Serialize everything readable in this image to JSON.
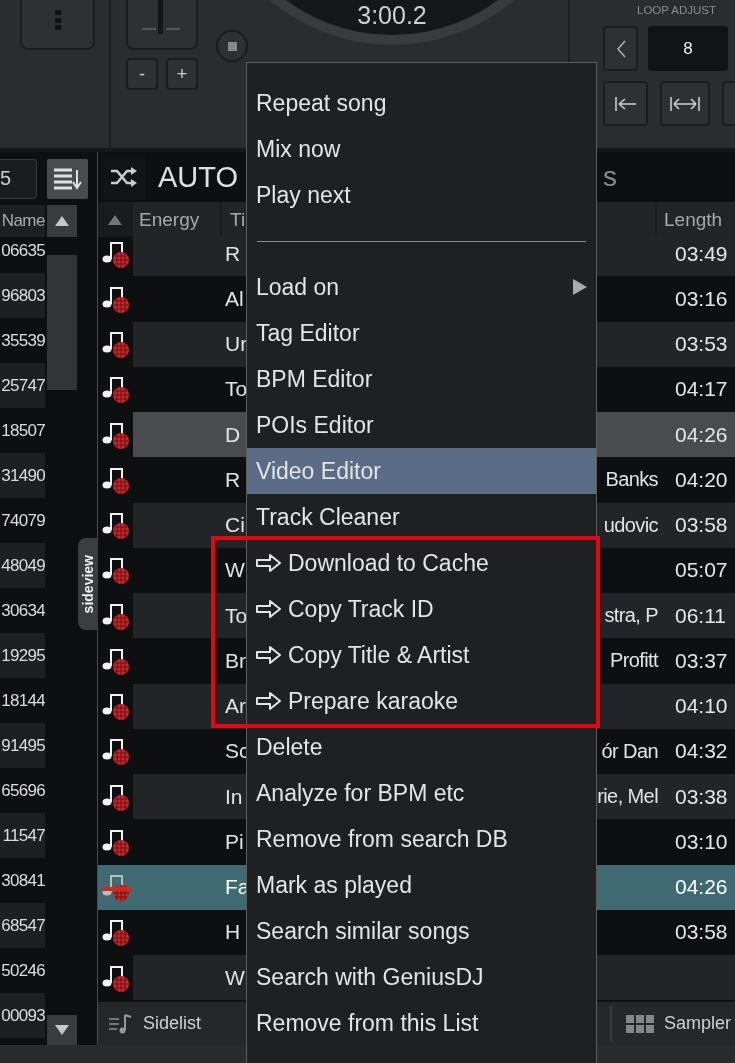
{
  "deck": {
    "time": "3:00.2",
    "minus": "-",
    "plus": "+",
    "loop_label": "LOOP ADJUST",
    "loop_value": "8"
  },
  "left_panel": {
    "field_value": "5",
    "column": "Name",
    "rows": [
      "06635",
      "96803",
      "35539",
      "25747",
      "18507",
      "31490",
      "74079",
      "48049",
      "30634",
      "19295",
      "18144",
      "91495",
      "65696",
      "11547",
      "30841",
      "68547",
      "50246",
      "00093"
    ]
  },
  "playlist": {
    "title": "AUTO",
    "title_tail": "s",
    "columns": {
      "energy": "Energy",
      "title": "Ti",
      "length": "Length"
    },
    "rows": [
      {
        "title": "R",
        "length": "03:49",
        "selected": false,
        "highlighted": false,
        "marked": false
      },
      {
        "title": "Al",
        "length": "03:16",
        "selected": false,
        "highlighted": false,
        "marked": false
      },
      {
        "title": "Ur",
        "length": "03:53",
        "selected": false,
        "highlighted": false,
        "marked": false
      },
      {
        "title": "To",
        "length": "04:17",
        "selected": false,
        "highlighted": false,
        "marked": false
      },
      {
        "title": "D",
        "length": "04:26",
        "selected": false,
        "highlighted": true,
        "marked": false
      },
      {
        "title": "R",
        "artist": "Banks",
        "length": "04:20",
        "selected": false,
        "highlighted": false,
        "marked": false
      },
      {
        "title": "Ci",
        "artist": "udovic",
        "length": "03:58",
        "selected": false,
        "highlighted": false,
        "marked": false
      },
      {
        "title": "W",
        "length": "05:07",
        "selected": false,
        "highlighted": false,
        "marked": false
      },
      {
        "title": "To",
        "artist": "stra, P",
        "length": "06:11",
        "selected": false,
        "highlighted": false,
        "marked": false
      },
      {
        "title": "Br",
        "artist": "Profitt",
        "length": "03:37",
        "selected": false,
        "highlighted": false,
        "marked": false
      },
      {
        "title": "Ar",
        "length": "04:10",
        "selected": false,
        "highlighted": false,
        "marked": false
      },
      {
        "title": "Sc",
        "artist": "ór Dan",
        "length": "04:32",
        "selected": false,
        "highlighted": false,
        "marked": false
      },
      {
        "title": "In",
        "artist": "rie, Mel",
        "length": "03:38",
        "selected": false,
        "highlighted": false,
        "marked": false
      },
      {
        "title": "Pi",
        "length": "03:10",
        "selected": false,
        "highlighted": false,
        "marked": false
      },
      {
        "title": "Fa",
        "length": "04:26",
        "selected": true,
        "highlighted": false,
        "marked": true
      },
      {
        "title": "H",
        "length": "03:58",
        "selected": false,
        "highlighted": false,
        "marked": false
      },
      {
        "title": "W",
        "selected": false,
        "highlighted": false,
        "marked": false
      }
    ]
  },
  "sideview_tab": "sideview",
  "bottom_bar": {
    "sidelist": "Sidelist",
    "sampler": "Sampler"
  },
  "context_menu": {
    "entries": [
      {
        "kind": "item",
        "label": "Repeat song",
        "highlighted": false,
        "outlined": false
      },
      {
        "kind": "item",
        "label": "Mix now",
        "highlighted": false,
        "outlined": false
      },
      {
        "kind": "item",
        "label": "Play next",
        "highlighted": false,
        "outlined": false
      },
      {
        "kind": "separator"
      },
      {
        "kind": "submenu",
        "label": "Load on",
        "highlighted": false,
        "outlined": false
      },
      {
        "kind": "item",
        "label": "Tag Editor",
        "highlighted": false,
        "outlined": false
      },
      {
        "kind": "item",
        "label": "BPM Editor",
        "highlighted": false,
        "outlined": false
      },
      {
        "kind": "item",
        "label": "POIs Editor",
        "highlighted": false,
        "outlined": false
      },
      {
        "kind": "item",
        "label": "Video Editor",
        "highlighted": true,
        "outlined": false
      },
      {
        "kind": "item",
        "label": "Track Cleaner",
        "highlighted": false,
        "outlined": false
      },
      {
        "kind": "action",
        "label": "Download to Cache",
        "highlighted": false,
        "outlined": true
      },
      {
        "kind": "action",
        "label": "Copy Track ID",
        "highlighted": false,
        "outlined": true
      },
      {
        "kind": "action",
        "label": "Copy Title & Artist",
        "highlighted": false,
        "outlined": true
      },
      {
        "kind": "action",
        "label": "Prepare karaoke",
        "highlighted": false,
        "outlined": true
      },
      {
        "kind": "item",
        "label": "Delete",
        "highlighted": false,
        "outlined": false
      },
      {
        "kind": "item",
        "label": "Analyze for BPM etc",
        "highlighted": false,
        "outlined": false
      },
      {
        "kind": "item",
        "label": "Remove from search DB",
        "highlighted": false,
        "outlined": false
      },
      {
        "kind": "item",
        "label": "Mark as played",
        "highlighted": false,
        "outlined": false
      },
      {
        "kind": "item",
        "label": "Search similar songs",
        "highlighted": false,
        "outlined": false
      },
      {
        "kind": "item",
        "label": "Search with GeniusDJ",
        "highlighted": false,
        "outlined": false
      },
      {
        "kind": "item",
        "label": "Remove from this List",
        "highlighted": false,
        "outlined": false
      }
    ]
  }
}
